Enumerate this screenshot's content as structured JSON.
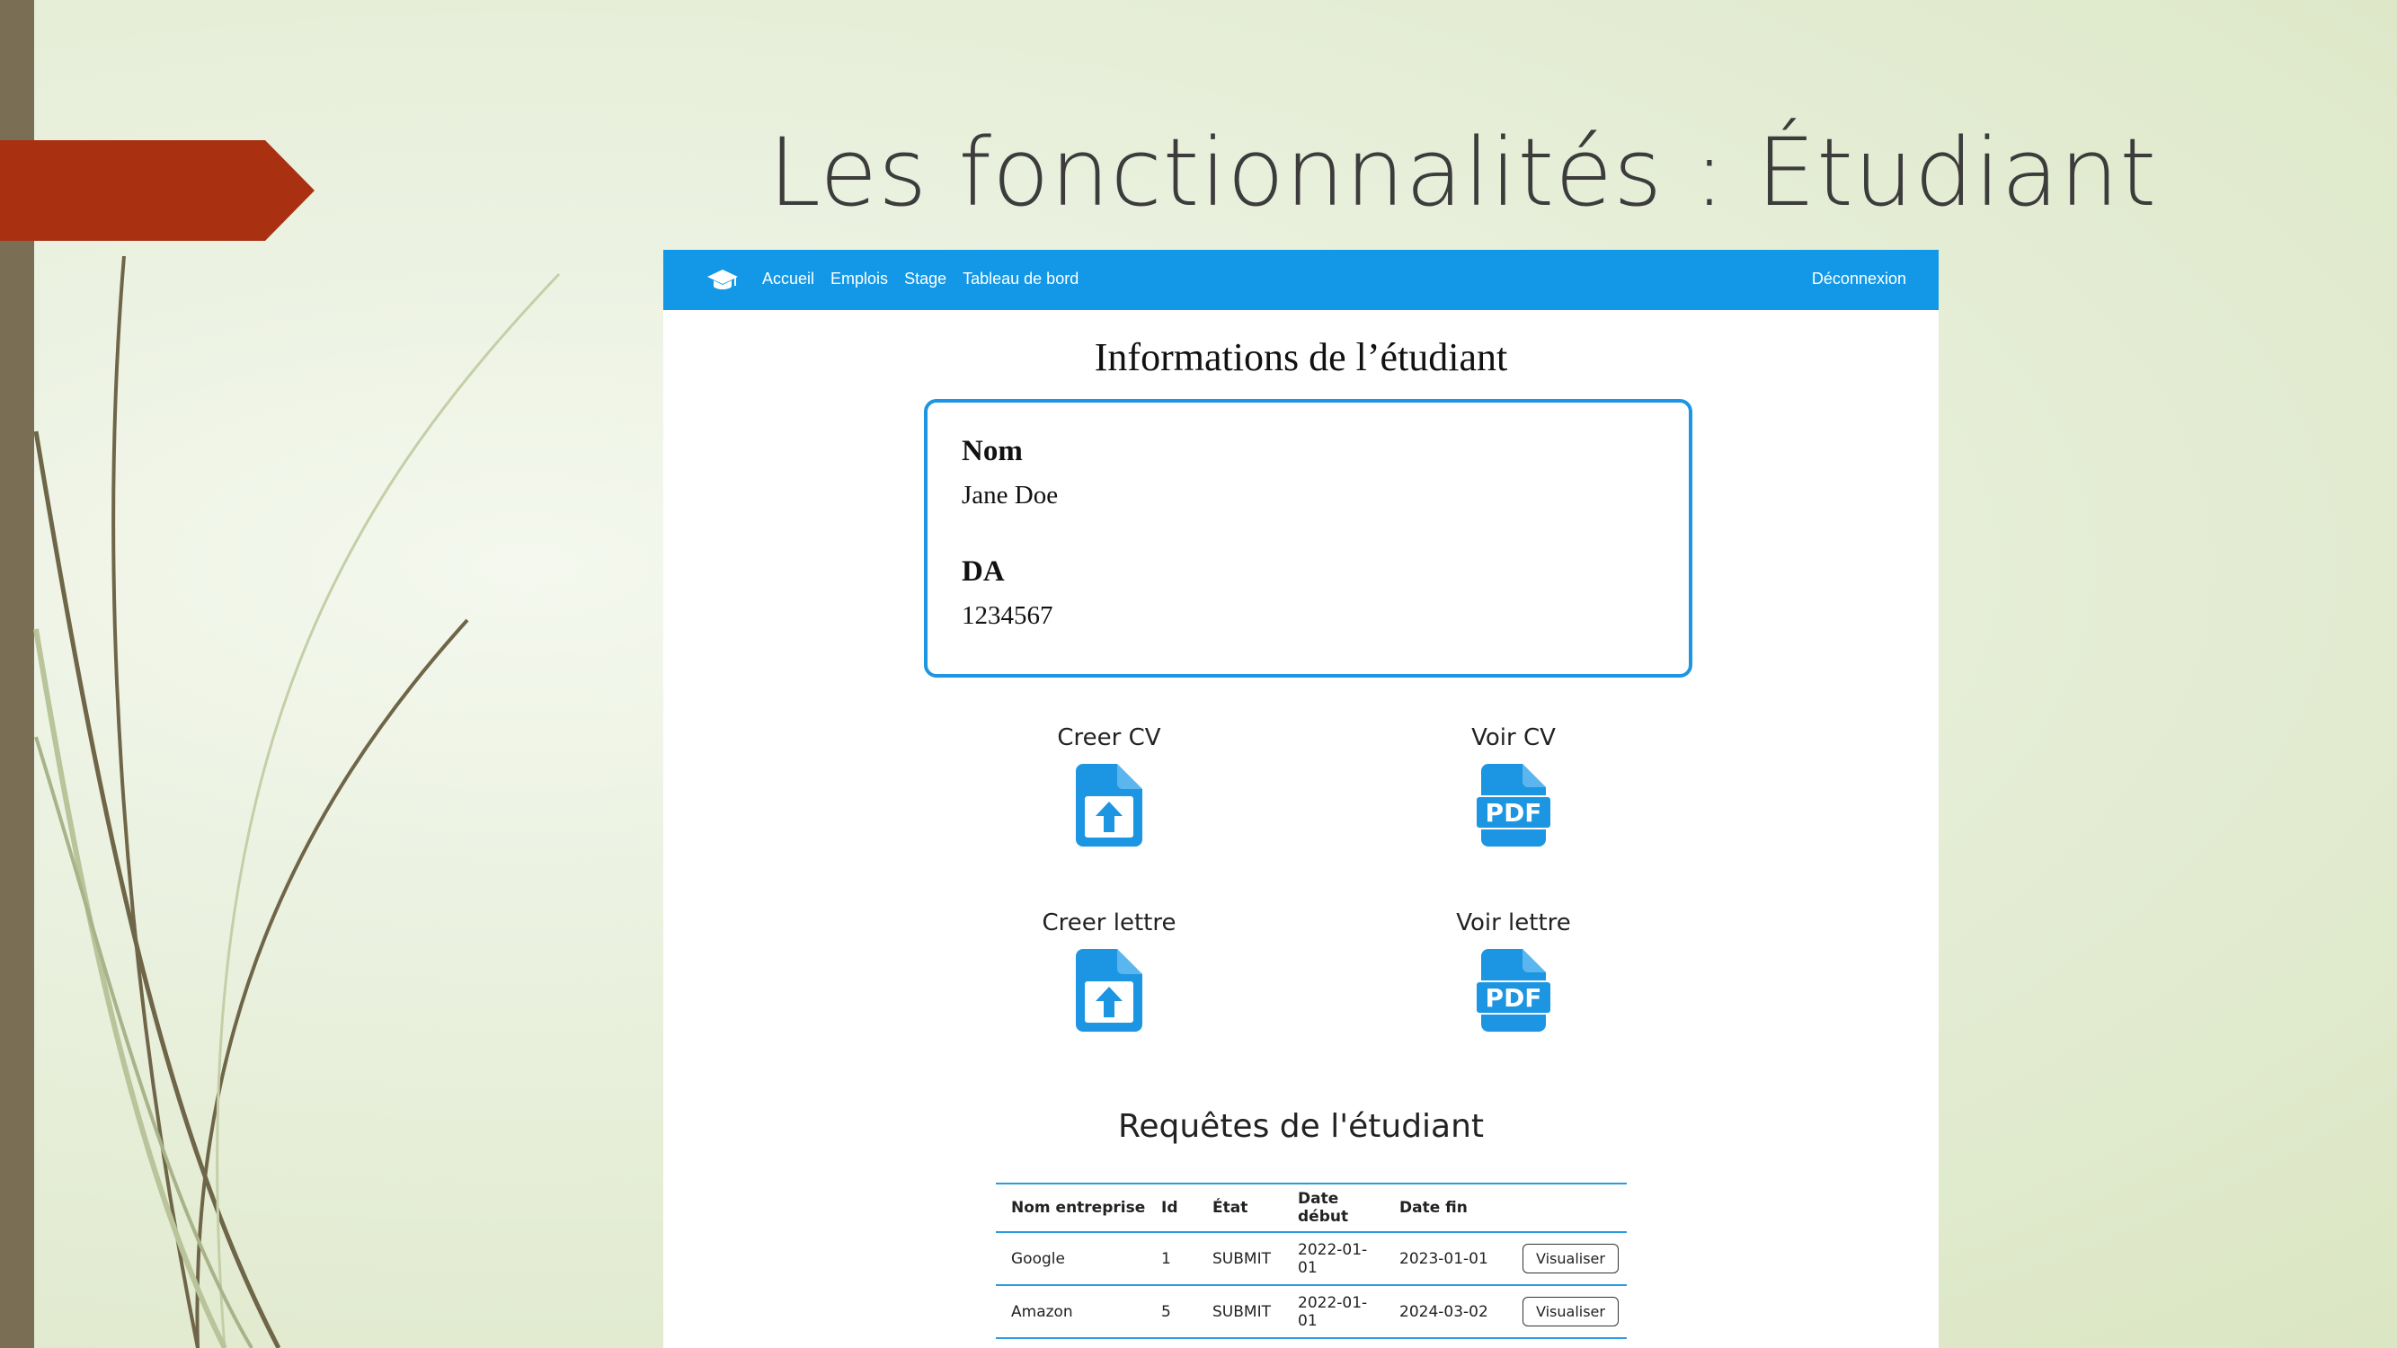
{
  "slide": {
    "title": "Les fonctionnalités : Étudiant"
  },
  "navbar": {
    "brand_icon": "graduation-cap-icon",
    "links": [
      "Accueil",
      "Emplois",
      "Stage",
      "Tableau de bord"
    ],
    "logout": "Déconnexion",
    "color": "#1298e6"
  },
  "student_info": {
    "title": "Informations de l’étudiant",
    "name_label": "Nom",
    "name_value": "Jane Doe",
    "da_label": "DA",
    "da_value": "1234567"
  },
  "documents": [
    {
      "label": "Creer CV",
      "icon": "file-upload-icon"
    },
    {
      "label": "Voir CV",
      "icon": "pdf-file-icon"
    },
    {
      "label": "Creer lettre",
      "icon": "file-upload-icon"
    },
    {
      "label": "Voir lettre",
      "icon": "pdf-file-icon"
    }
  ],
  "requests": {
    "title": "Requêtes de l'étudiant",
    "columns": [
      "Nom entreprise",
      "Id",
      "État",
      "Date début",
      "Date fin",
      ""
    ],
    "rows": [
      {
        "company": "Google",
        "id": "1",
        "state": "SUBMIT",
        "start": "2022-01-01",
        "end": "2023-01-01",
        "action": "Visualiser"
      },
      {
        "company": "Amazon",
        "id": "5",
        "state": "SUBMIT",
        "start": "2022-01-01",
        "end": "2024-03-02",
        "action": "Visualiser"
      }
    ]
  },
  "colors": {
    "accent": "#1c95e2",
    "slide_tab": "#a93112",
    "slide_bar": "#7a6f55"
  }
}
